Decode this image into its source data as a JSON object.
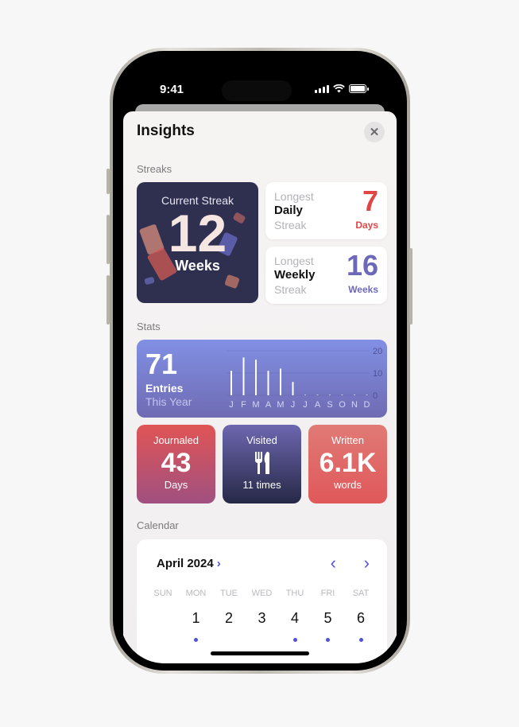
{
  "status_bar": {
    "time": "9:41",
    "icons": [
      "cellular-signal-icon",
      "wifi-icon",
      "battery-icon"
    ]
  },
  "sheet": {
    "title": "Insights",
    "close_icon": "close-icon"
  },
  "streaks": {
    "section_label": "Streaks",
    "current": {
      "label": "Current Streak",
      "value": "12",
      "unit": "Weeks"
    },
    "daily": {
      "line1": "Longest",
      "line2": "Daily",
      "line3": "Streak",
      "value": "7",
      "unit": "Days",
      "color": "#e04545"
    },
    "weekly": {
      "line1": "Longest",
      "line2": "Weekly",
      "line3": "Streak",
      "value": "16",
      "unit": "Weeks",
      "color": "#6d68b8"
    }
  },
  "stats": {
    "section_label": "Stats",
    "entries": {
      "value": "71",
      "label": "Entries",
      "sublabel": "This Year"
    },
    "journaled": {
      "title": "Journaled",
      "value": "43",
      "unit": "Days"
    },
    "visited": {
      "title": "Visited",
      "icon": "fork-knife-icon",
      "unit": "11 times"
    },
    "written": {
      "title": "Written",
      "value": "6.1K",
      "unit": "words"
    }
  },
  "chart_data": {
    "type": "bar",
    "categories": [
      "J",
      "F",
      "M",
      "A",
      "M",
      "J",
      "J",
      "A",
      "S",
      "O",
      "N",
      "D"
    ],
    "values": [
      11,
      17,
      16,
      11,
      12,
      6,
      0,
      0,
      0,
      0,
      0,
      0
    ],
    "title": "",
    "xlabel": "",
    "ylabel": "",
    "yticks": [
      "0",
      "10",
      "20"
    ],
    "ylim": [
      0,
      20
    ],
    "grid": true
  },
  "calendar": {
    "section_label": "Calendar",
    "month": "April 2024",
    "weekdays": [
      "SUN",
      "MON",
      "TUE",
      "WED",
      "THU",
      "FRI",
      "SAT"
    ],
    "days": [
      {
        "d": "",
        "dot": false
      },
      {
        "d": "1",
        "dot": true
      },
      {
        "d": "2",
        "dot": false
      },
      {
        "d": "3",
        "dot": false
      },
      {
        "d": "4",
        "dot": true
      },
      {
        "d": "5",
        "dot": true
      },
      {
        "d": "6",
        "dot": true
      }
    ]
  }
}
